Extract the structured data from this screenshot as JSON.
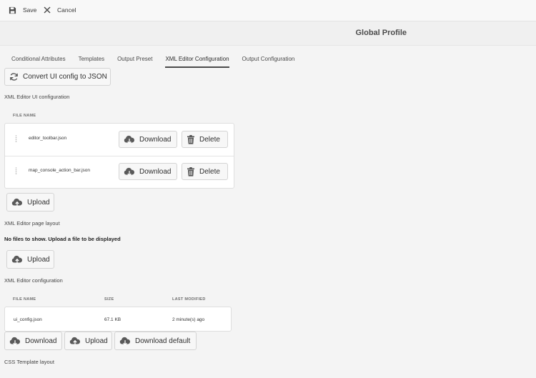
{
  "toolbar": {
    "save_label": "Save",
    "cancel_label": "Cancel"
  },
  "header": {
    "title": "Global Profile"
  },
  "tabs": [
    {
      "label": "Conditional Attributes",
      "active": false
    },
    {
      "label": "Templates",
      "active": false
    },
    {
      "label": "Output Preset",
      "active": false
    },
    {
      "label": "XML Editor Configuration",
      "active": true
    },
    {
      "label": "Output Configuration",
      "active": false
    }
  ],
  "convert_button": {
    "label": "Convert UI config to JSON",
    "icon": "refresh-icon"
  },
  "ui_config": {
    "title": "XML Editor UI configuration",
    "column_header": "FILE NAME",
    "files": [
      {
        "name": "editor_toolbar.json",
        "download_label": "Download",
        "delete_label": "Delete"
      },
      {
        "name": "map_console_action_bar.json",
        "download_label": "Download",
        "delete_label": "Delete"
      }
    ],
    "upload_label": "Upload"
  },
  "page_layout": {
    "title": "XML Editor page layout",
    "empty_message": "No files to show. Upload a file to be displayed",
    "upload_label": "Upload"
  },
  "editor_config": {
    "title": "XML Editor configuration",
    "columns": [
      "FILE NAME",
      "SIZE",
      "LAST MODIFIED"
    ],
    "rows": [
      {
        "file_name": "ui_config.json",
        "size": "67.1 KB",
        "last_modified": "2 minute(s) ago"
      }
    ],
    "download_label": "Download",
    "upload_label": "Upload",
    "download_default_label": "Download default"
  },
  "css_template": {
    "title": "CSS Template layout"
  },
  "colors": {
    "background": "#f4f4f4",
    "card": "#ffffff",
    "active_tab_underline": "#4b4b4b"
  }
}
